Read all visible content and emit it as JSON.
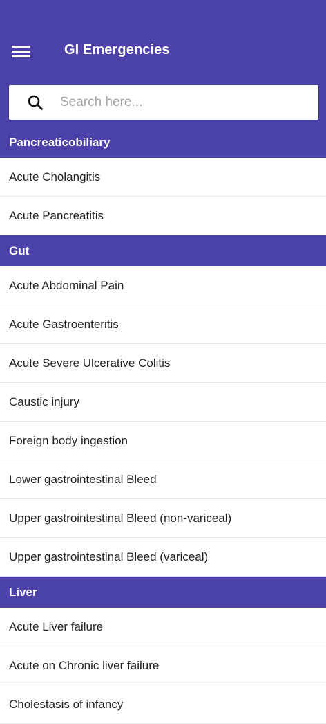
{
  "app_bar": {
    "title": "GI Emergencies",
    "menu_icon": "hamburger-menu-icon",
    "color": "#4a42a8"
  },
  "search": {
    "icon": "search-icon",
    "placeholder": "Search here...",
    "value": ""
  },
  "sections": [
    {
      "title": "Pancreaticobiliary",
      "items": [
        "Acute Cholangitis",
        "Acute Pancreatitis"
      ]
    },
    {
      "title": "Gut",
      "items": [
        "Acute Abdominal Pain",
        "Acute Gastroenteritis",
        "Acute Severe Ulcerative Colitis",
        "Caustic injury",
        "Foreign body ingestion",
        "Lower gastrointestinal Bleed",
        "Upper gastrointestinal Bleed (non-variceal)",
        "Upper gastrointestinal Bleed (variceal)"
      ]
    },
    {
      "title": "Liver",
      "items": [
        "Acute Liver failure",
        "Acute on Chronic liver failure",
        "Cholestasis of infancy"
      ]
    }
  ]
}
